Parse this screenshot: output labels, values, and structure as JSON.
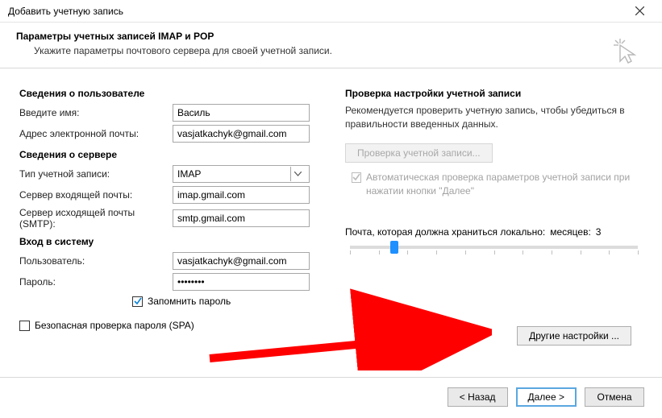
{
  "window": {
    "title": "Добавить учетную запись"
  },
  "header": {
    "title": "Параметры учетных записей IMAP и POP",
    "subtitle": "Укажите параметры почтового сервера для своей учетной записи."
  },
  "left": {
    "userInfoTitle": "Сведения о пользователе",
    "nameLabel": "Введите имя:",
    "nameValue": "Василь",
    "emailLabel": "Адрес электронной почты:",
    "emailValue": "vasjatkachyk@gmail.com",
    "serverInfoTitle": "Сведения о сервере",
    "accountTypeLabel": "Тип учетной записи:",
    "accountTypeValue": "IMAP",
    "incomingLabel": "Сервер входящей почты:",
    "incomingValue": "imap.gmail.com",
    "outgoingLabel": "Сервер исходящей почты (SMTP):",
    "outgoingValue": "smtp.gmail.com",
    "loginTitle": "Вход в систему",
    "userLabel": "Пользователь:",
    "userValue": "vasjatkachyk@gmail.com",
    "passwordLabel": "Пароль:",
    "passwordValue": "********",
    "rememberLabel": "Запомнить пароль",
    "spaLabel": "Безопасная проверка пароля (SPA)"
  },
  "right": {
    "testTitle": "Проверка настройки учетной записи",
    "testDesc": "Рекомендуется проверить учетную запись, чтобы убедиться в правильности введенных данных.",
    "testButton": "Проверка учетной записи...",
    "autoTestLabel": "Автоматическая проверка параметров учетной записи при нажатии кнопки \"Далее\"",
    "sliderLabelLeft": "Почта, которая должна храниться локально:",
    "sliderMonthsLabel": "месяцев:",
    "sliderMonthsValue": "3",
    "otherSettings": "Другие настройки ..."
  },
  "footer": {
    "back": "< Назад",
    "next": "Далее >",
    "cancel": "Отмена"
  }
}
